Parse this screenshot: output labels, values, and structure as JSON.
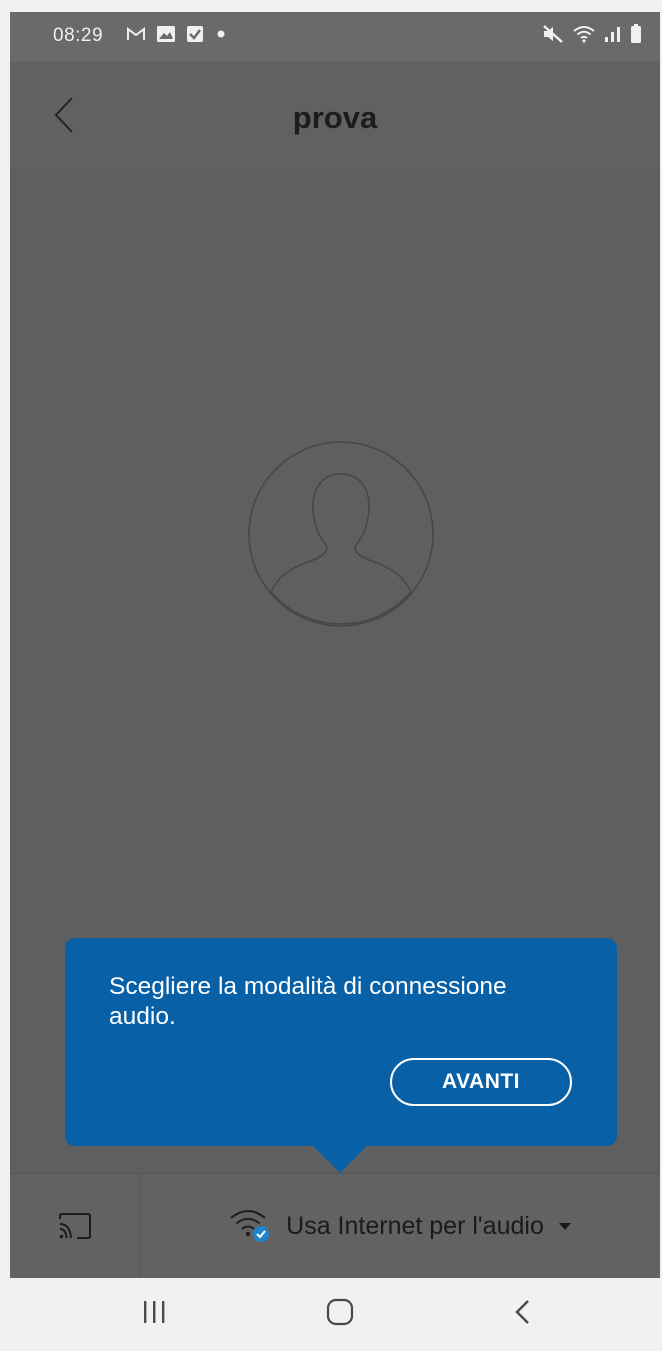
{
  "status_bar": {
    "time": "08:29",
    "left_icons": [
      "gmail-icon",
      "gallery-icon",
      "checkbox-icon",
      "dot-icon"
    ],
    "right_icons": [
      "mute-icon",
      "wifi-icon",
      "signal-icon",
      "battery-icon"
    ]
  },
  "header": {
    "title": "prova",
    "back_icon": "chevron-left-icon"
  },
  "avatar": {
    "icon": "user-silhouette-icon"
  },
  "tooltip": {
    "message": "Scegliere la modalità di connessione audio.",
    "button_label": "AVANTI",
    "color": "#0860a7"
  },
  "bottom_bar": {
    "cast_icon": "cast-icon",
    "audio_icon": "wifi-check-icon",
    "audio_label": "Usa Internet per l'audio",
    "dropdown_icon": "caret-down-icon"
  },
  "nav_bar": {
    "buttons": [
      "recent-apps",
      "home",
      "back"
    ]
  },
  "colors": {
    "dim_background": "#5f5f5f",
    "accent_blue": "#0860a7",
    "check_badge": "#1e86c8"
  }
}
